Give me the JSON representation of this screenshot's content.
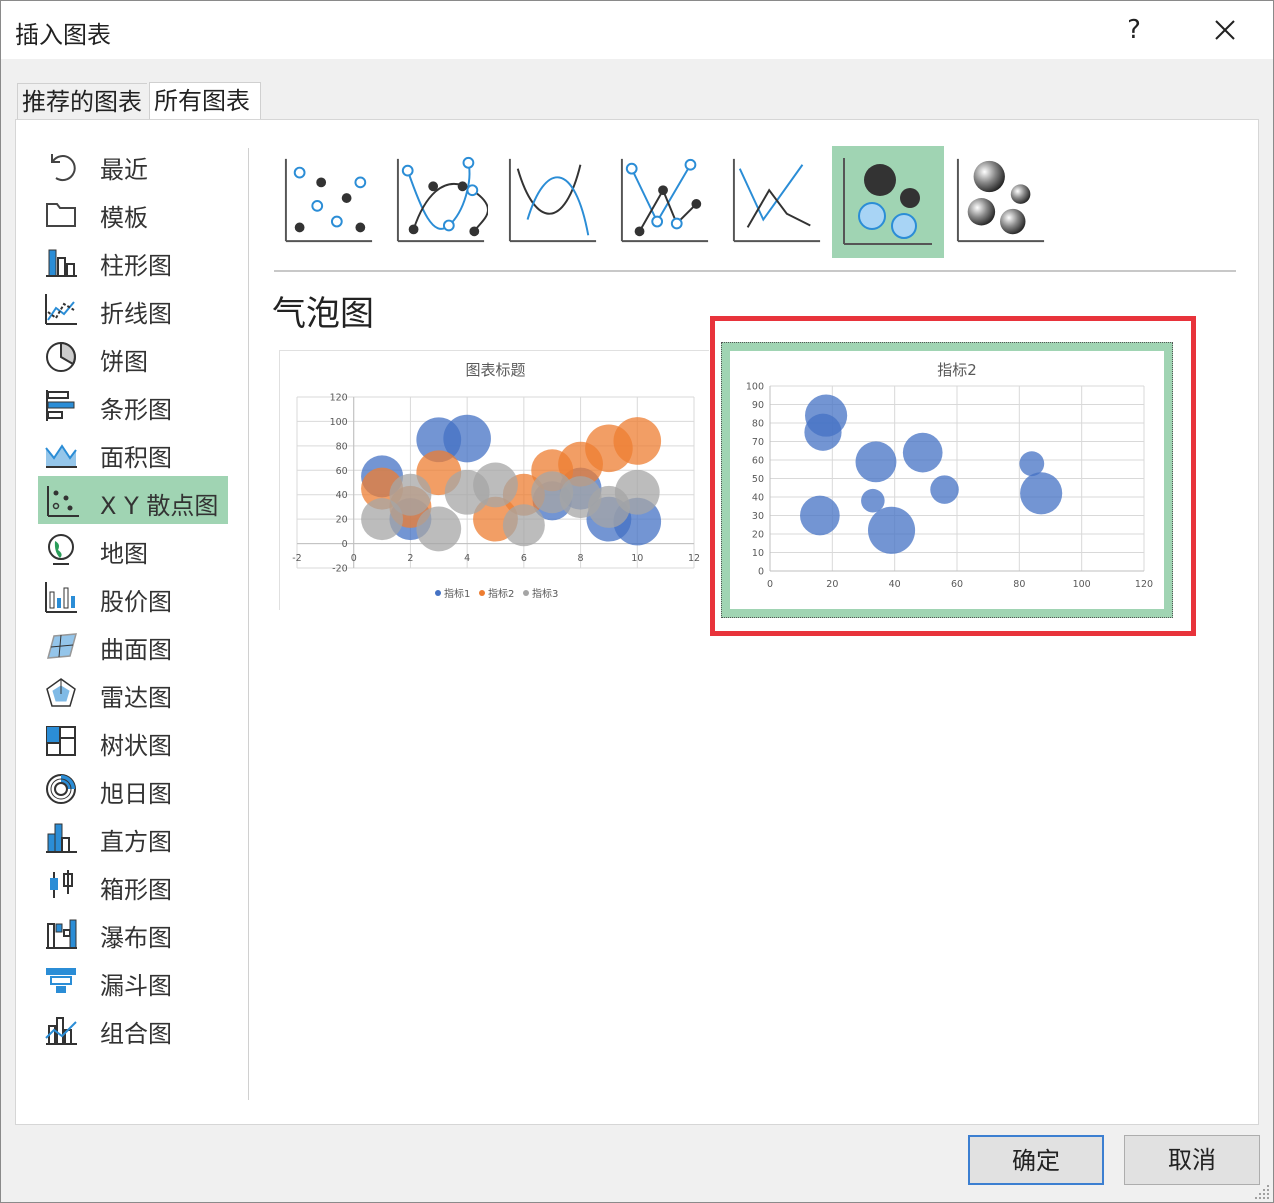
{
  "window": {
    "title": "插入图表",
    "help_label": "?",
    "close_icon": "close-icon"
  },
  "tabs": [
    {
      "label": "推荐的图表",
      "active": false
    },
    {
      "label": "所有图表",
      "active": true
    }
  ],
  "sidebar": {
    "items": [
      {
        "label": "最近",
        "icon": "recent-icon"
      },
      {
        "label": "模板",
        "icon": "folder-icon"
      },
      {
        "label": "柱形图",
        "icon": "column-chart-icon"
      },
      {
        "label": "折线图",
        "icon": "line-chart-icon"
      },
      {
        "label": "饼图",
        "icon": "pie-chart-icon"
      },
      {
        "label": "条形图",
        "icon": "bar-chart-icon"
      },
      {
        "label": "面积图",
        "icon": "area-chart-icon"
      },
      {
        "label": "X Y 散点图",
        "icon": "scatter-chart-icon",
        "selected": true
      },
      {
        "label": "地图",
        "icon": "map-chart-icon"
      },
      {
        "label": "股价图",
        "icon": "stock-chart-icon"
      },
      {
        "label": "曲面图",
        "icon": "surface-chart-icon"
      },
      {
        "label": "雷达图",
        "icon": "radar-chart-icon"
      },
      {
        "label": "树状图",
        "icon": "treemap-chart-icon"
      },
      {
        "label": "旭日图",
        "icon": "sunburst-chart-icon"
      },
      {
        "label": "直方图",
        "icon": "histogram-chart-icon"
      },
      {
        "label": "箱形图",
        "icon": "box-whisker-chart-icon"
      },
      {
        "label": "瀑布图",
        "icon": "waterfall-chart-icon"
      },
      {
        "label": "漏斗图",
        "icon": "funnel-chart-icon"
      },
      {
        "label": "组合图",
        "icon": "combo-chart-icon"
      }
    ]
  },
  "subtypes": [
    {
      "icon": "scatter-icon"
    },
    {
      "icon": "scatter-smooth-lines-markers-icon"
    },
    {
      "icon": "scatter-smooth-lines-icon"
    },
    {
      "icon": "scatter-straight-lines-markers-icon"
    },
    {
      "icon": "scatter-straight-lines-icon"
    },
    {
      "icon": "bubble-icon",
      "selected": true
    },
    {
      "icon": "3d-bubble-icon"
    }
  ],
  "section_title": "气泡图",
  "colors": {
    "selected_bg": "#a0d4b3",
    "series1": "#4472c4",
    "series2": "#ed7d31",
    "series3": "#a5a5a5",
    "highlight_box": "#e8333b",
    "ok_border": "#3c7fd1"
  },
  "chart_data": [
    {
      "type": "scatter",
      "subtype": "bubble",
      "title": "图表标题",
      "xlim": [
        -2,
        12
      ],
      "ylim": [
        -20,
        120
      ],
      "xticks": [
        "-2",
        "0",
        "2",
        "4",
        "6",
        "8",
        "10",
        "12"
      ],
      "yticks": [
        "-20",
        "0",
        "20",
        "40",
        "60",
        "80",
        "100",
        "120"
      ],
      "legend_position": "bottom",
      "series": [
        {
          "name": "指标1",
          "color": "#4472c4",
          "points": [
            {
              "x": 1,
              "y": 55,
              "size": 3
            },
            {
              "x": 3,
              "y": 85,
              "size": 3.2
            },
            {
              "x": 4,
              "y": 86,
              "size": 3.4
            },
            {
              "x": 2,
              "y": 20,
              "size": 3
            },
            {
              "x": 7,
              "y": 35,
              "size": 2.8
            },
            {
              "x": 9,
              "y": 20,
              "size": 3.2
            },
            {
              "x": 10,
              "y": 18,
              "size": 3.4
            },
            {
              "x": 8,
              "y": 45,
              "size": 3
            }
          ]
        },
        {
          "name": "指标2",
          "color": "#ed7d31",
          "points": [
            {
              "x": 1,
              "y": 45,
              "size": 3
            },
            {
              "x": 3,
              "y": 58,
              "size": 3.2
            },
            {
              "x": 5,
              "y": 20,
              "size": 3.2
            },
            {
              "x": 6,
              "y": 40,
              "size": 3
            },
            {
              "x": 7,
              "y": 60,
              "size": 3
            },
            {
              "x": 8,
              "y": 65,
              "size": 3.2
            },
            {
              "x": 9,
              "y": 78,
              "size": 3.4
            },
            {
              "x": 10,
              "y": 84,
              "size": 3.4
            },
            {
              "x": 2,
              "y": 30,
              "size": 3
            }
          ]
        },
        {
          "name": "指标3",
          "color": "#a5a5a5",
          "points": [
            {
              "x": 1,
              "y": 20,
              "size": 3
            },
            {
              "x": 2,
              "y": 40,
              "size": 3
            },
            {
              "x": 3,
              "y": 12,
              "size": 3.2
            },
            {
              "x": 4,
              "y": 42,
              "size": 3.2
            },
            {
              "x": 5,
              "y": 48,
              "size": 3.2
            },
            {
              "x": 6,
              "y": 15,
              "size": 3
            },
            {
              "x": 7,
              "y": 42,
              "size": 3
            },
            {
              "x": 8,
              "y": 38,
              "size": 3
            },
            {
              "x": 9,
              "y": 30,
              "size": 3
            },
            {
              "x": 10,
              "y": 42,
              "size": 3.2
            }
          ]
        }
      ]
    },
    {
      "type": "scatter",
      "subtype": "bubble",
      "title": "指标2",
      "xlim": [
        0,
        120
      ],
      "ylim": [
        0,
        100
      ],
      "xticks": [
        "0",
        "20",
        "40",
        "60",
        "80",
        "100",
        "120"
      ],
      "yticks": [
        "0",
        "10",
        "20",
        "30",
        "40",
        "50",
        "60",
        "70",
        "80",
        "90",
        "100"
      ],
      "series": [
        {
          "color": "#4472c4",
          "points": [
            {
              "x": 18,
              "y": 84,
              "size": 3.4
            },
            {
              "x": 17,
              "y": 75,
              "size": 3
            },
            {
              "x": 16,
              "y": 30,
              "size": 3.2
            },
            {
              "x": 34,
              "y": 59,
              "size": 3.3
            },
            {
              "x": 33,
              "y": 38,
              "size": 1.9
            },
            {
              "x": 39,
              "y": 22,
              "size": 3.8
            },
            {
              "x": 49,
              "y": 64,
              "size": 3.2
            },
            {
              "x": 56,
              "y": 44,
              "size": 2.3
            },
            {
              "x": 84,
              "y": 58,
              "size": 2
            },
            {
              "x": 87,
              "y": 42,
              "size": 3.4
            }
          ]
        }
      ]
    }
  ],
  "buttons": {
    "ok_label": "确定",
    "cancel_label": "取消"
  }
}
